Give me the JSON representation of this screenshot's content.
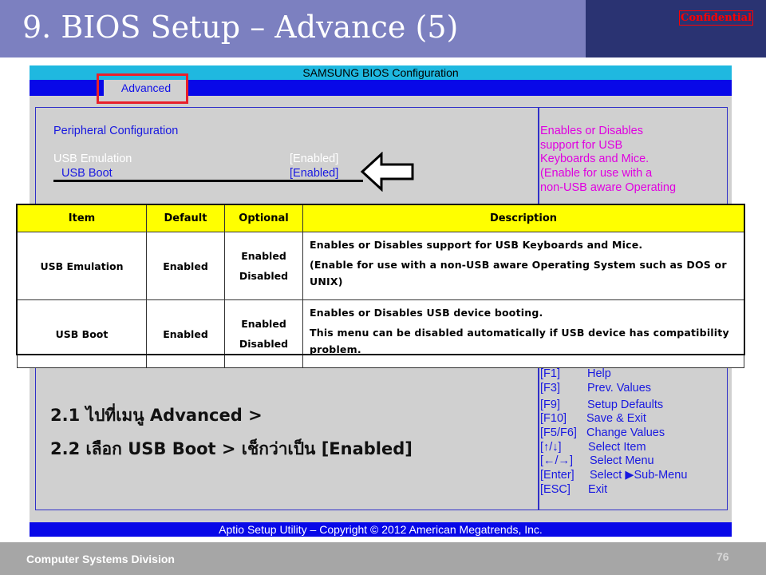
{
  "slide": {
    "title": "9. BIOS Setup – Advance (5)",
    "confidential_label": "Confidential",
    "footer_text": "Computer Systems  Division",
    "page_number": "76"
  },
  "bios": {
    "window_title": "SAMSUNG BIOS Configuration",
    "active_tab": "Advanced",
    "section_heading": "Peripheral Configuration",
    "items": [
      {
        "label": "USB Emulation",
        "value": "[Enabled]"
      },
      {
        "label": "USB Boot",
        "value": "[Enabled]"
      }
    ],
    "help_text": [
      "Enables or Disables",
      "support for USB",
      "Keyboards and Mice.",
      "(Enable for use with a",
      "non-USB aware Operating"
    ],
    "keys": [
      {
        "key": "[F1]",
        "action": "Help"
      },
      {
        "key": "[F3]",
        "action": "Prev. Values"
      },
      {
        "key": "[F9]",
        "action": "Setup Defaults"
      },
      {
        "key": "[F10]",
        "action": "Save & Exit"
      },
      {
        "key": "[F5/F6]",
        "action": "Change Values"
      },
      {
        "key": "[↑/↓]",
        "action": "Select Item"
      },
      {
        "key": "[←/→]",
        "action": "Select Menu"
      },
      {
        "key": "[Enter]",
        "action": "Select ▶Sub-Menu"
      },
      {
        "key": "[ESC]",
        "action": "Exit"
      }
    ],
    "footer": "Aptio Setup Utility – Copyright © 2012 American Megatrends, Inc."
  },
  "table": {
    "headers": [
      "Item",
      "Default",
      "Optional",
      "Description"
    ],
    "rows": [
      {
        "item": "USB Emulation",
        "default": "Enabled",
        "options": [
          "Enabled",
          "Disabled"
        ],
        "desc1": "Enables or Disables support  for  USB Keyboards and Mice.",
        "desc2": "(Enable for use with a non-USB aware Operating System such as DOS or UNIX)"
      },
      {
        "item": "USB Boot",
        "default": "Enabled",
        "options": [
          "Enabled",
          "Disabled"
        ],
        "desc1": "Enables or Disables USB device booting.",
        "desc2": "This  menu  can  be  disabled  automatically  if USB device  has compatibility  problem."
      }
    ]
  },
  "steps": [
    "2.1 ไปที่เมนู Advanced >",
    "2.2 เลือก USB Boot >  เช็กว่าเป็น [Enabled]"
  ],
  "colors": {
    "header_bg": "#7c80c0",
    "header_dark": "#2a3372",
    "bios_blue": "#0808e8",
    "bios_cyan": "#1fb8e0",
    "help_magenta": "#e000e0",
    "table_header": "#ffff00",
    "highlight_red": "#e8202a"
  }
}
